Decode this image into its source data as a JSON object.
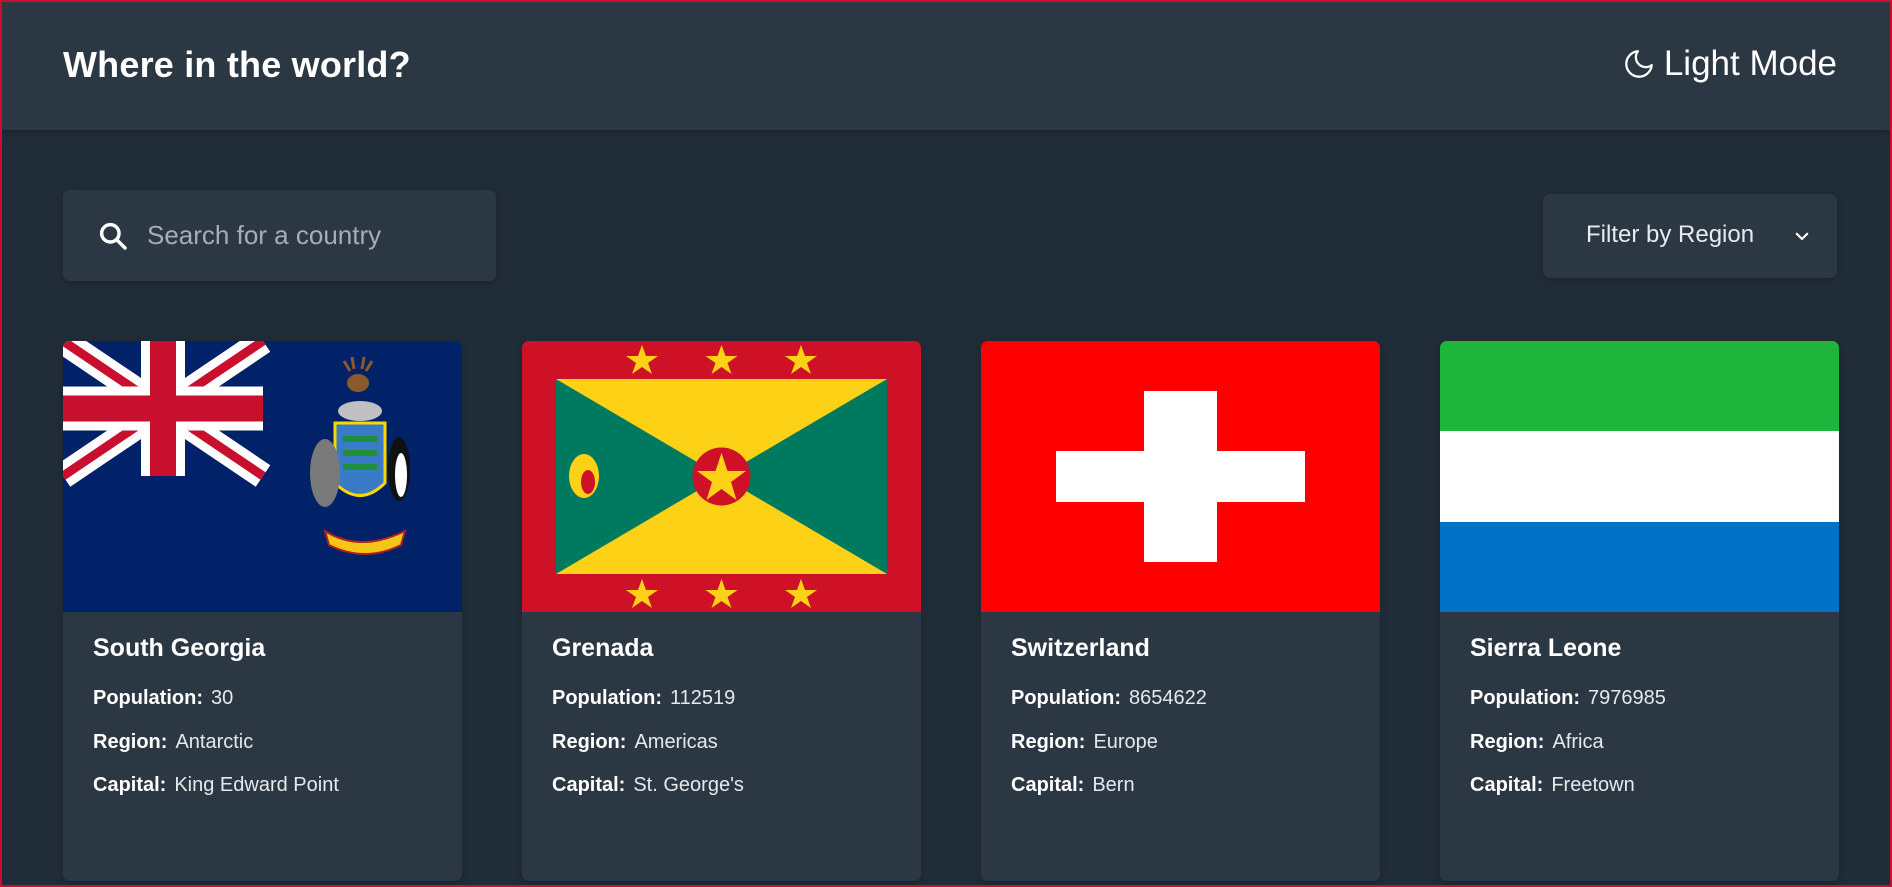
{
  "header": {
    "title": "Where in the world?",
    "theme_toggle_label": "Light Mode",
    "theme_toggle_icon": "moon-icon"
  },
  "search": {
    "placeholder": "Search for a country",
    "value": "",
    "icon": "search-icon"
  },
  "filter": {
    "label": "Filter by Region",
    "icon": "chevron-down-icon"
  },
  "colors": {
    "background": "#202c37",
    "surface": "#2b3743",
    "text": "#ffffff",
    "placeholder": "#a5adb5"
  },
  "countries": [
    {
      "name": "South Georgia",
      "population_label": "Population:",
      "population": "30",
      "region_label": "Region:",
      "region": "Antarctic",
      "capital_label": "Capital:",
      "capital": "King Edward Point",
      "flag": "south-georgia-flag"
    },
    {
      "name": "Grenada",
      "population_label": "Population:",
      "population": "112519",
      "region_label": "Region:",
      "region": "Americas",
      "capital_label": "Capital:",
      "capital": "St. George's",
      "flag": "grenada-flag"
    },
    {
      "name": "Switzerland",
      "population_label": "Population:",
      "population": "8654622",
      "region_label": "Region:",
      "region": "Europe",
      "capital_label": "Capital:",
      "capital": "Bern",
      "flag": "switzerland-flag"
    },
    {
      "name": "Sierra Leone",
      "population_label": "Population:",
      "population": "7976985",
      "region_label": "Region:",
      "region": "Africa",
      "capital_label": "Capital:",
      "capital": "Freetown",
      "flag": "sierra-leone-flag"
    }
  ]
}
